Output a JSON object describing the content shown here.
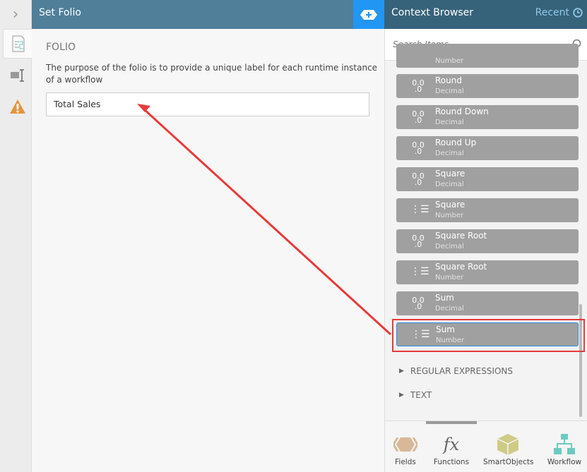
{
  "header": {
    "title": "Set Folio"
  },
  "folio": {
    "heading": "FOLIO",
    "description": "The purpose of the folio is to provide a unique label for each runtime instance of a workflow",
    "value": "Total Sales"
  },
  "context_browser": {
    "title": "Context Browser",
    "recent_label": "Recent",
    "search_placeholder": "Search Items",
    "partial_item_type": "Number",
    "items": [
      {
        "name": "Round",
        "type": "Decimal",
        "icon": "decimal-icon"
      },
      {
        "name": "Round Down",
        "type": "Decimal",
        "icon": "decimal-icon"
      },
      {
        "name": "Round Up",
        "type": "Decimal",
        "icon": "decimal-icon"
      },
      {
        "name": "Square",
        "type": "Decimal",
        "icon": "decimal-icon"
      },
      {
        "name": "Square",
        "type": "Number",
        "icon": "number-list-icon"
      },
      {
        "name": "Square Root",
        "type": "Decimal",
        "icon": "decimal-icon"
      },
      {
        "name": "Square Root",
        "type": "Number",
        "icon": "number-list-icon"
      },
      {
        "name": "Sum",
        "type": "Decimal",
        "icon": "decimal-icon"
      },
      {
        "name": "Sum",
        "type": "Number",
        "icon": "number-list-icon",
        "selected": true
      }
    ],
    "categories": [
      "REGULAR EXPRESSIONS",
      "TEXT"
    ]
  },
  "bottom_tabs": [
    {
      "label": "Fields"
    },
    {
      "label": "Functions"
    },
    {
      "label": "SmartObjects"
    },
    {
      "label": "Workflow"
    }
  ],
  "colors": {
    "header": "#4f7f99",
    "context_header": "#36637a",
    "accent": "#2196f3",
    "annotation": "#e83a3a"
  }
}
